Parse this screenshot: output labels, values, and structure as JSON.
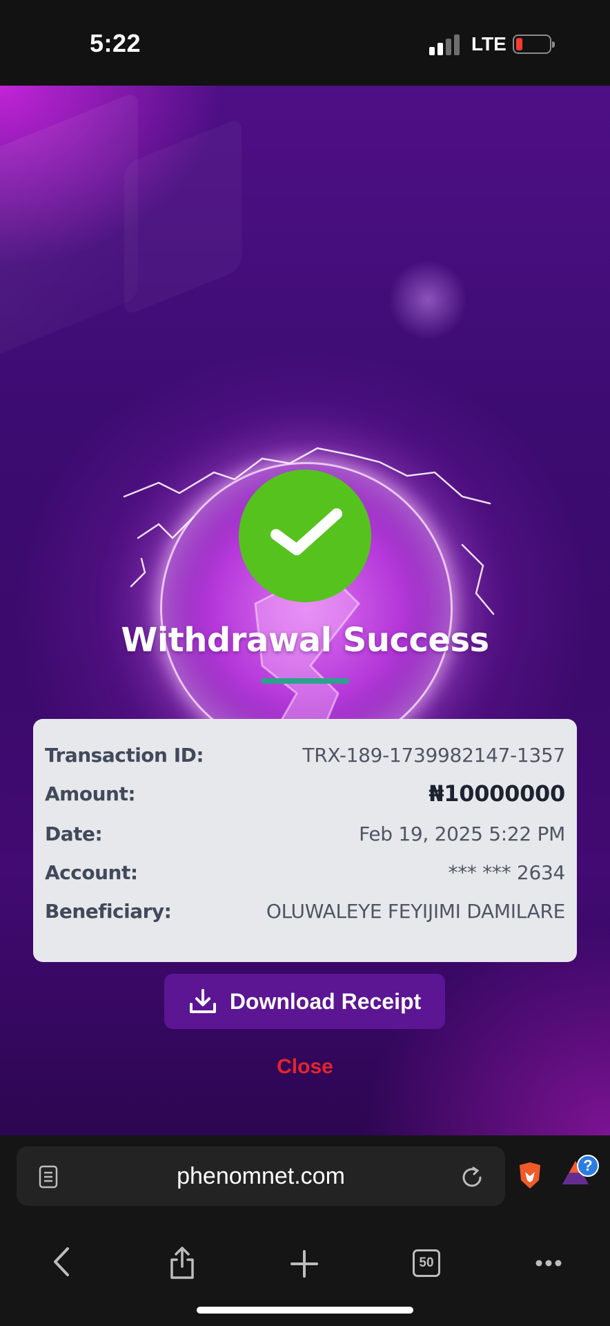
{
  "status_bar": {
    "time": "5:22",
    "network": "LTE",
    "battery_level": 0.12,
    "signal_bars_active": 2,
    "signal_bars_total": 4
  },
  "receipt": {
    "title": "Withdrawal Success",
    "rows": [
      {
        "label": "Transaction ID:",
        "value": "TRX-189-1739982147-1357"
      },
      {
        "label": "Amount:",
        "value": "₦10000000"
      },
      {
        "label": "Date:",
        "value": "Feb 19, 2025 5:22 PM"
      },
      {
        "label": "Account:",
        "value": "*** *** 2634"
      },
      {
        "label": "Beneficiary:",
        "value": "OLUWALEYE FEYIJIMI DAMILARE"
      }
    ],
    "download_label": "Download Receipt",
    "close_label": "Close"
  },
  "browser": {
    "url": "phenomnet.com",
    "tab_count": "50",
    "help_badge": "?"
  },
  "colors": {
    "success": "#56c21e",
    "button": "#5c1593",
    "close": "#e3262b",
    "card": "#e7e8ec",
    "accent_underline": "#2aa38a"
  }
}
